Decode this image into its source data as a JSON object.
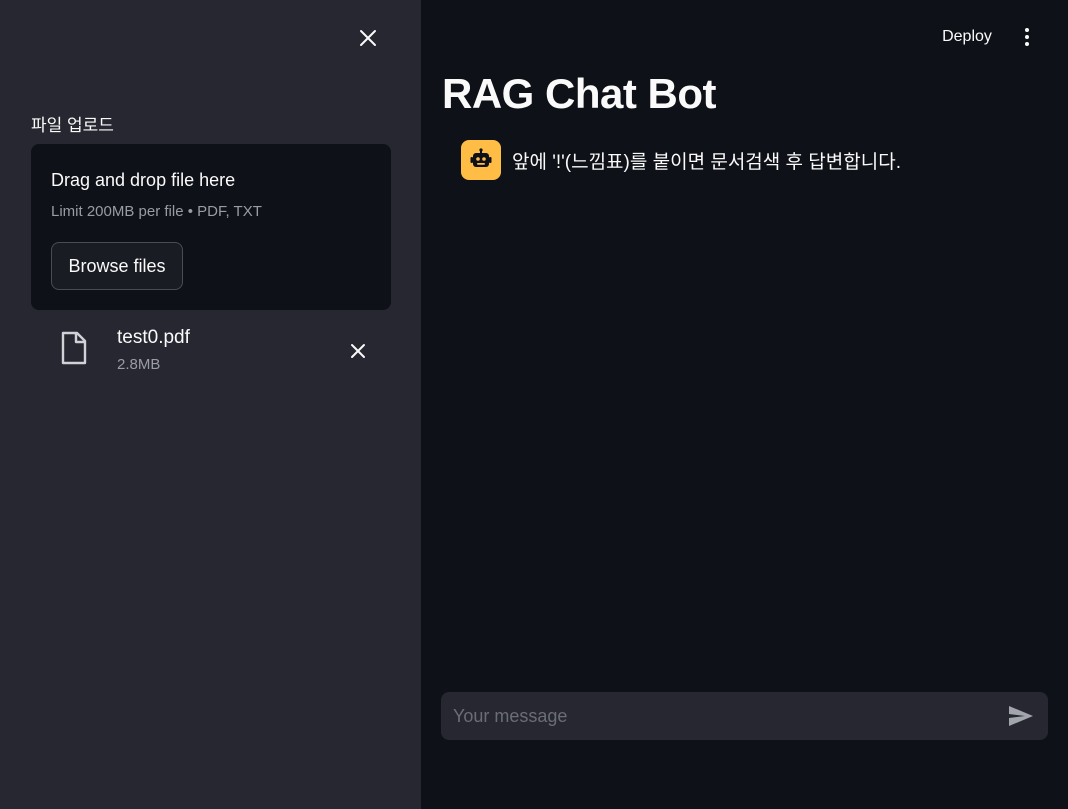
{
  "sidebar": {
    "close_icon": "close-icon",
    "upload_label": "파일 업로드",
    "dropzone": {
      "title": "Drag and drop file here",
      "limit_text": "Limit 200MB per file • PDF, TXT",
      "browse_label": "Browse files"
    },
    "uploaded_file": {
      "icon": "file-icon",
      "name": "test0.pdf",
      "size": "2.8MB",
      "remove_icon": "close-icon"
    }
  },
  "header": {
    "deploy_label": "Deploy",
    "menu_icon": "kebab-menu-icon"
  },
  "main": {
    "title": "RAG Chat Bot",
    "messages": [
      {
        "role": "assistant",
        "avatar_icon": "robot-icon",
        "avatar_color": "#ffbd45",
        "text": "앞에 '!'(느낌표)를 붙이면 문서검색 후 답변합니다."
      }
    ],
    "chat_input": {
      "placeholder": "Your message",
      "value": "",
      "send_icon": "send-icon"
    }
  },
  "colors": {
    "main_bg": "#0e1117",
    "sidebar_bg": "#262730",
    "avatar_bg": "#ffbd45",
    "muted_text": "#9a9ca4"
  }
}
